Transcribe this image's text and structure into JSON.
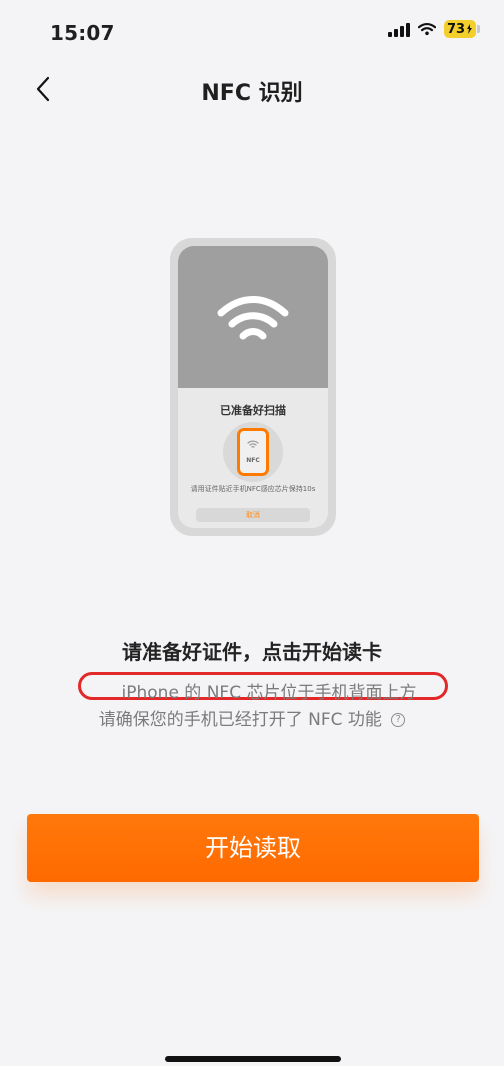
{
  "status_bar": {
    "time": "15:07",
    "battery": "73",
    "icons": [
      "signal-icon",
      "wifi-icon",
      "battery-icon",
      "charging-icon"
    ]
  },
  "header": {
    "title": "NFC 识别",
    "back_icon": "chevron-left-icon"
  },
  "illustration": {
    "status_text": "已准备好扫描",
    "nfc_label": "NFC",
    "hint_text": "请用证件贴近手机NFC感应芯片保持10s",
    "cancel_label": "取消",
    "icons": [
      "wifi-icon",
      "mini-phone-icon"
    ]
  },
  "content": {
    "headline": "请准备好证件，点击开始读卡",
    "notice_line_1": "iPhone 的 NFC 芯片位于手机背面上方",
    "notice_line_2": "请确保您的手机已经打开了 NFC 功能",
    "help_icon": "help-circle-icon"
  },
  "actions": {
    "start_button_label": "开始读取"
  },
  "colors": {
    "accent": "#ff7a00",
    "highlight": "#e22828",
    "background": "#f4f4f6",
    "text_primary": "#232323",
    "text_secondary": "#7b7b7b"
  }
}
